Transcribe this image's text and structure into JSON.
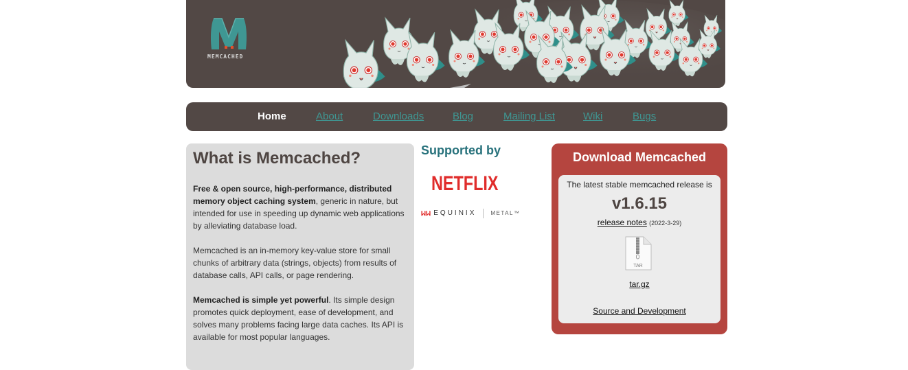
{
  "header": {
    "logo_text": "MEMCACHED",
    "colors": {
      "background": "#524845",
      "accent": "#3f9793",
      "brand_red": "#b5453f"
    }
  },
  "nav": {
    "items": [
      {
        "label": "Home",
        "active": true
      },
      {
        "label": "About",
        "active": false
      },
      {
        "label": "Downloads",
        "active": false
      },
      {
        "label": "Blog",
        "active": false
      },
      {
        "label": "Mailing List",
        "active": false
      },
      {
        "label": "Wiki",
        "active": false
      },
      {
        "label": "Bugs",
        "active": false
      }
    ]
  },
  "about": {
    "title": "What is Memcached?",
    "p1_bold": "Free & open source, high-performance, distributed memory object caching system",
    "p1_rest": ", generic in nature, but intended for use in speeding up dynamic web applications by alleviating database load.",
    "p2": "Memcached is an in-memory key-value store for small chunks of arbitrary data (strings, objects) from results of database calls, API calls, or page rendering.",
    "p3_bold": "Memcached is simple yet powerful",
    "p3_rest": ". Its simple design promotes quick deployment, ease of development, and solves many problems facing large data caches. Its API is available for most popular languages."
  },
  "supporters": {
    "title": "Supported by",
    "netflix": "NETFLIX",
    "equinix_icon": "ᥕᥕ",
    "equinix": "EQUINIX",
    "metal": "METAL™"
  },
  "download": {
    "title": "Download Memcached",
    "latest_label": "The latest stable memcached release is",
    "version": "v1.6.15",
    "release_notes": "release notes",
    "release_date": "(2022-3-29)",
    "tar_icon_label": "TAR",
    "tar_link": "tar.gz",
    "source_link": "Source and Development"
  }
}
